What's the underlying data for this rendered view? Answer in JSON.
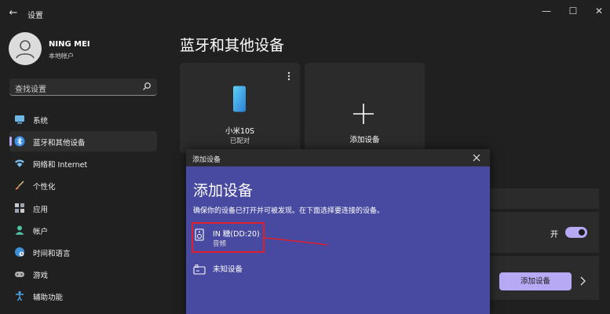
{
  "window": {
    "back_glyph": "←",
    "title": "设置",
    "minimize_glyph": "—",
    "maximize_glyph": "☐",
    "close_glyph": "✕"
  },
  "profile": {
    "name": "NING MEI",
    "account_type": "本地帐户"
  },
  "search": {
    "placeholder": "查找设置"
  },
  "sidebar": {
    "items": [
      {
        "label": "系统",
        "icon": "monitor-icon",
        "active": false
      },
      {
        "label": "蓝牙和其他设备",
        "icon": "bluetooth-icon",
        "active": true
      },
      {
        "label": "网络和 Internet",
        "icon": "wifi-icon",
        "active": false
      },
      {
        "label": "个性化",
        "icon": "brush-icon",
        "active": false
      },
      {
        "label": "应用",
        "icon": "apps-icon",
        "active": false
      },
      {
        "label": "帐户",
        "icon": "person-icon",
        "active": false
      },
      {
        "label": "时间和语言",
        "icon": "globe-clock-icon",
        "active": false
      },
      {
        "label": "游戏",
        "icon": "gamepad-icon",
        "active": false
      },
      {
        "label": "辅助功能",
        "icon": "accessibility-icon",
        "active": false
      }
    ]
  },
  "main": {
    "title": "蓝牙和其他设备",
    "paired_device": {
      "name": "小米10S",
      "status": "已配对"
    },
    "add_card_label": "添加设备",
    "toggle_label": "开",
    "toggle_on": true,
    "add_device_button": "添加设备"
  },
  "dialog": {
    "bar_title": "添加设备",
    "heading": "添加设备",
    "description": "确保你的设备已打开并可被发现。在下面选择要连接的设备。",
    "devices": [
      {
        "name": "IN 糖(DD:20)",
        "type": "音频",
        "icon": "speaker-icon"
      },
      {
        "name": "未知设备",
        "type": "",
        "icon": "unknown-device-icon"
      }
    ]
  },
  "colors": {
    "background": "#202020",
    "panel": "#2b2b2b",
    "accent": "#b8a9f5",
    "dialog": "#4849a1",
    "annotation": "#e01f2a"
  }
}
